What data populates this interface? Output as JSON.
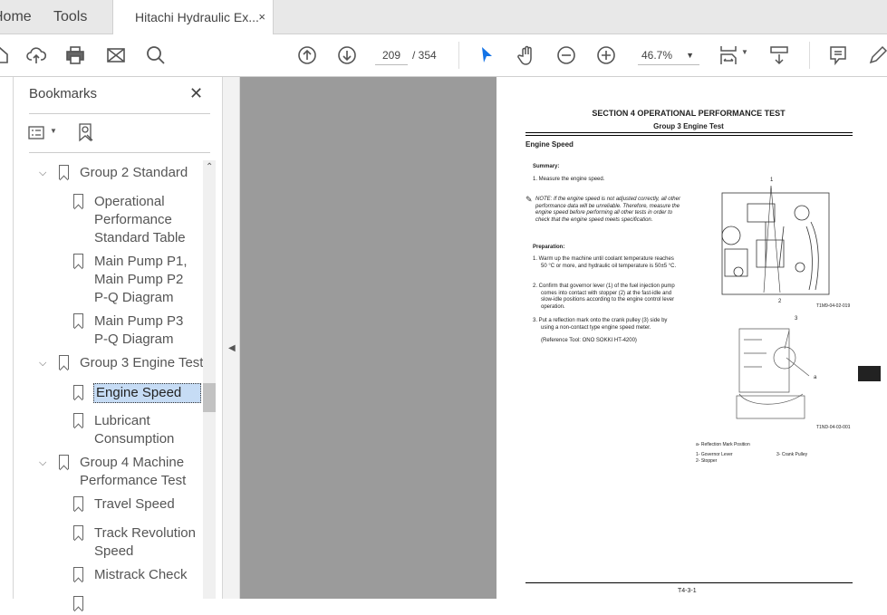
{
  "tabs": {
    "home": "Home",
    "tools": "Tools",
    "document": "Hitachi Hydraulic Ex...",
    "close": "×"
  },
  "toolbar": {
    "page_current": "209",
    "page_total": "/ 354",
    "zoom": "46.7%"
  },
  "panel": {
    "title": "Bookmarks",
    "close": "✕"
  },
  "bookmarks": [
    {
      "label": "Group 2 Standard",
      "level": 0
    },
    {
      "label": "Operational Performance Standard Table",
      "level": 1
    },
    {
      "label": "Main Pump P1, Main Pump P2 P-Q Diagram",
      "level": 1
    },
    {
      "label": "Main Pump P3 P-Q Diagram",
      "level": 1
    },
    {
      "label": "Group 3 Engine Test",
      "level": 0
    },
    {
      "label": "Engine Speed",
      "level": 1,
      "selected": true
    },
    {
      "label": "Lubricant Consumption",
      "level": 1
    },
    {
      "label": "Group 4 Machine Performance Test",
      "level": 0
    },
    {
      "label": "Travel Speed",
      "level": 1
    },
    {
      "label": "Track Revolution Speed",
      "level": 1
    },
    {
      "label": "Mistrack Check",
      "level": 1
    }
  ],
  "document": {
    "section": "SECTION 4 OPERATIONAL PERFORMANCE TEST",
    "group": "Group 3 Engine Test",
    "heading": "Engine Speed",
    "summary_label": "Summary:",
    "summary_1": "1.  Measure the engine speed.",
    "note": "NOTE:   If the engine speed is not adjusted correctly, all other performance data will be unreliable. Therefore, measure the engine speed before performing all other tests in order to check that the engine speed meets specification.",
    "prep_label": "Preparation:",
    "prep_1": "1.  Warm up the machine until coolant temperature reaches 50 °C or more, and hydraulic oil temperature is 50±5 °C.",
    "prep_2": "2.  Confirm that governor lever (1) of the fuel injection pump comes into contact with stopper (2) at the fast-idle and slow-idle positions according to the engine control lever operation.",
    "prep_3": "3.  Put a reflection mark onto the crank pulley (3) side by using a non-contact type engine speed meter.",
    "ref": "(Reference Tool: ONO SOKKI HT-4200)",
    "fig1_id": "T1M9-04-02-019",
    "fig2_id": "T1ND-04-03-001",
    "fig1_labels": [
      "1",
      "2"
    ],
    "fig2_labels": [
      "3",
      "a"
    ],
    "legend_a": "a-     Reflection Mark Position",
    "legend_1": "1-     Governor Lever",
    "legend_2": "2-     Stopper",
    "legend_3": "3-     Crank Pulley",
    "footer": "T4-3-1"
  }
}
